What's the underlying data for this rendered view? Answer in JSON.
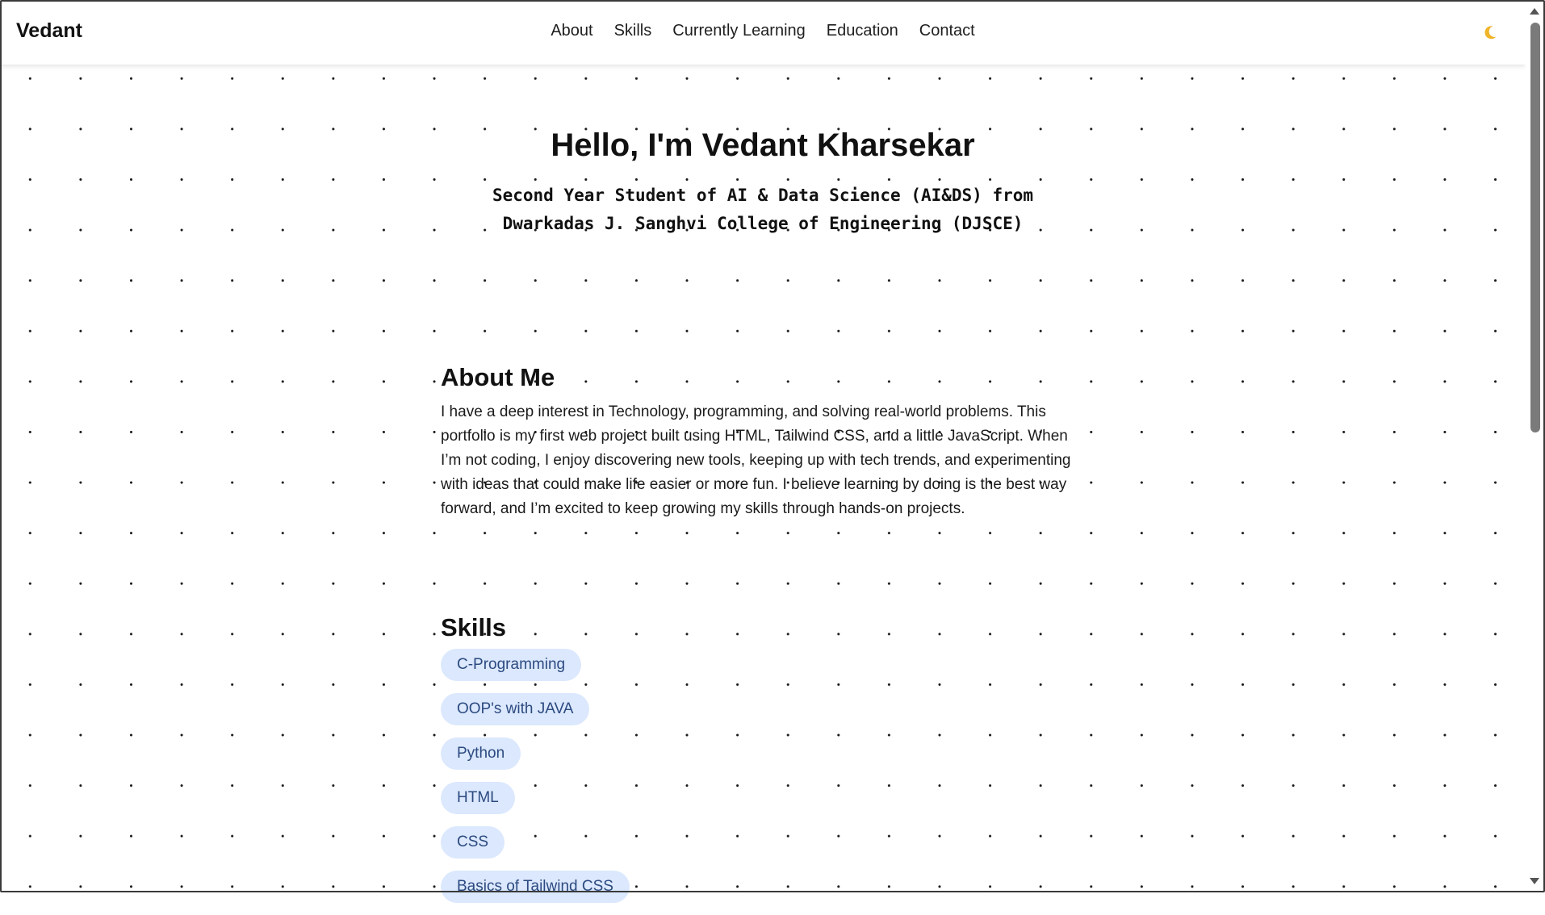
{
  "brand": "Vedant",
  "nav": {
    "items": [
      {
        "label": "About"
      },
      {
        "label": "Skills"
      },
      {
        "label": "Currently Learning"
      },
      {
        "label": "Education"
      },
      {
        "label": "Contact"
      }
    ],
    "theme_icon": "moon-icon"
  },
  "hero": {
    "title": "Hello, I'm Vedant Kharsekar",
    "subtitle_line1": "Second Year Student of AI & Data Science (AI&DS) from",
    "subtitle_line2": "Dwarkadas J. Sanghvi College of Engineering (DJSCE)"
  },
  "about": {
    "heading": "About Me",
    "text": "I have a deep interest in Technology, programming, and solving real-world problems. This portfolio is my first web project built using HTML, Tailwind CSS, and a little JavaScript. When I’m not coding, I enjoy discovering new tools, keeping up with tech trends, and experimenting with ideas that could make life easier or more fun. I believe learning by doing is the best way forward, and I’m excited to keep growing my skills through hands-on projects."
  },
  "skills": {
    "heading": "Skills",
    "items": [
      {
        "label": "C-Programming"
      },
      {
        "label": "OOP's with JAVA"
      },
      {
        "label": "Python"
      },
      {
        "label": "HTML"
      },
      {
        "label": "CSS"
      },
      {
        "label": "Basics of Tailwind CSS"
      }
    ]
  },
  "colors": {
    "skill_pill_bg": "#dbe8fd",
    "skill_pill_text": "#2c4a80",
    "moon": "#f0b429"
  }
}
